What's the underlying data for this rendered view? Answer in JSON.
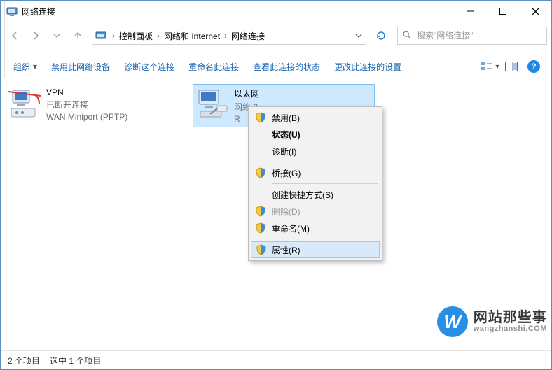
{
  "window": {
    "title": "网络连接"
  },
  "nav": {
    "crumbs": [
      "控制面板",
      "网络和 Internet",
      "网络连接"
    ],
    "search_placeholder": "搜索\"网络连接\""
  },
  "toolbar": {
    "organize": "组织",
    "actions": [
      "禁用此网络设备",
      "诊断这个连接",
      "重命名此连接",
      "查看此连接的状态",
      "更改此连接的设置"
    ]
  },
  "items": [
    {
      "name": "VPN",
      "line2": "已断开连接",
      "line3": "WAN Miniport (PPTP)",
      "selected": false,
      "type": "dialup"
    },
    {
      "name": "以太网",
      "line2": "网络 2",
      "line3": "R",
      "selected": true,
      "type": "ethernet"
    }
  ],
  "context_menu": [
    {
      "label": "禁用(B)",
      "shield": true
    },
    {
      "label": "状态(U)",
      "bold": true
    },
    {
      "label": "诊断(I)"
    },
    {
      "sep": true
    },
    {
      "label": "桥接(G)",
      "shield": true
    },
    {
      "sep": true
    },
    {
      "label": "创建快捷方式(S)"
    },
    {
      "label": "删除(D)",
      "shield": true,
      "disabled": true
    },
    {
      "label": "重命名(M)",
      "shield": true
    },
    {
      "sep": true
    },
    {
      "label": "属性(R)",
      "shield": true,
      "hover": true
    }
  ],
  "status": {
    "count": "2 个项目",
    "selected": "选中 1 个项目"
  },
  "watermark": {
    "cn": "网站那些事",
    "en": "wangzhanshi.COM",
    "badge": "W"
  }
}
